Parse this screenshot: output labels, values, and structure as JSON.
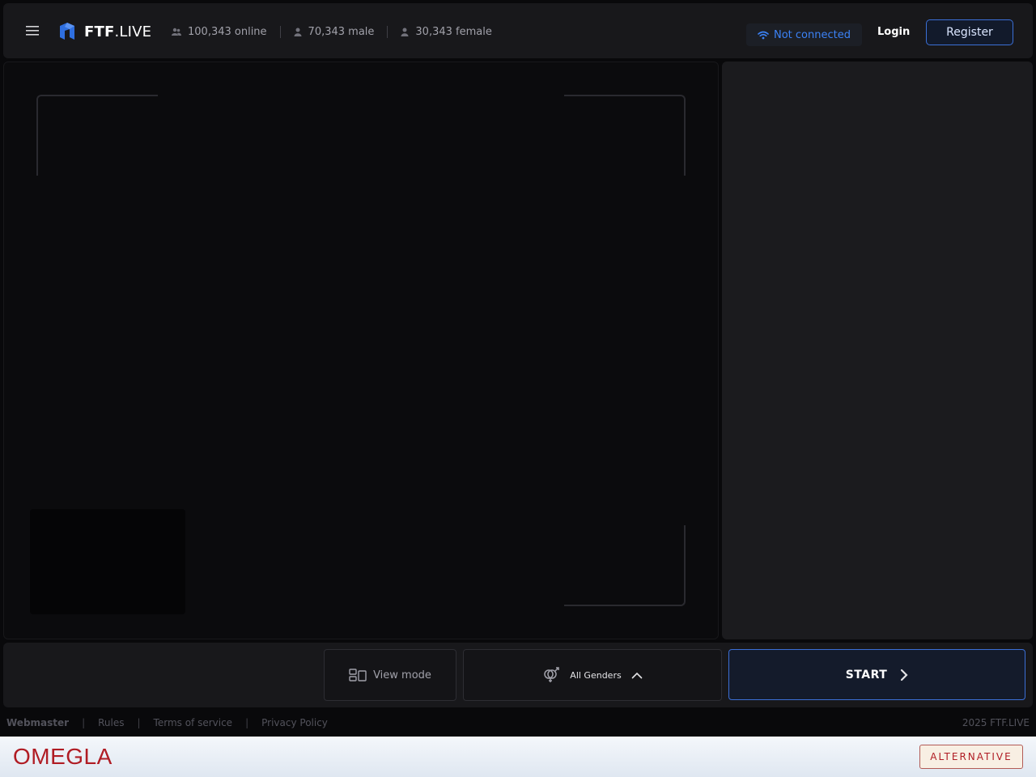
{
  "header": {
    "logo": {
      "bold": "FTF",
      "light": ".LIVE"
    },
    "stats": [
      {
        "icon": "users-icon",
        "label": "100,343 online"
      },
      {
        "icon": "user-icon",
        "label": "70,343 male"
      },
      {
        "icon": "user-icon",
        "label": "30,343 female"
      }
    ],
    "connection_status": "Not connected",
    "login_label": "Login",
    "register_label": "Register"
  },
  "controls": {
    "view_mode_label": "View mode",
    "gender_label": "All Genders",
    "start_label": "START"
  },
  "footer": {
    "webmaster": "Webmaster",
    "rules": "Rules",
    "terms": "Terms of service",
    "privacy": "Privacy Policy",
    "copyright": "2025 FTF.LIVE"
  },
  "banner": {
    "brand": "OMEGLA",
    "button": "ALTERNATIVE"
  },
  "colors": {
    "accent": "#3b82f6",
    "brand_red": "#b01c24",
    "background": "#09090b",
    "panel": "#18181b"
  }
}
